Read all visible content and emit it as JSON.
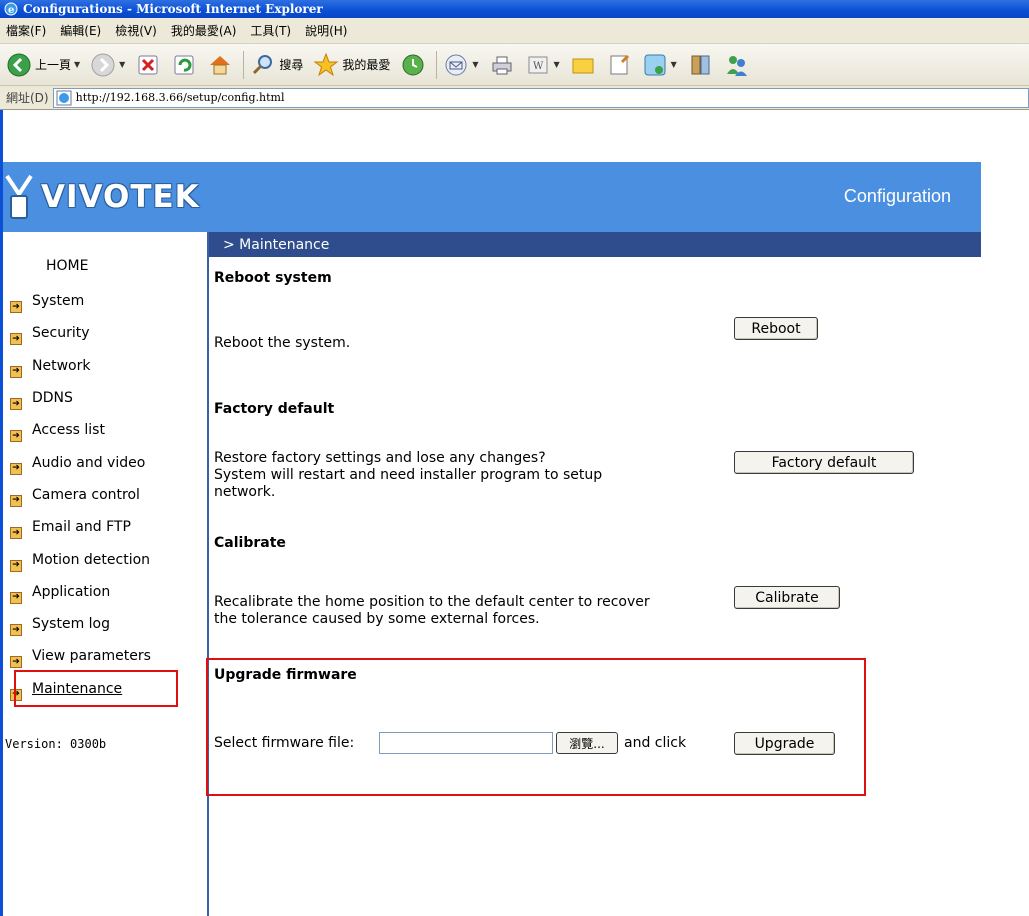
{
  "window": {
    "title": "Configurations - Microsoft Internet Explorer"
  },
  "menu": [
    "檔案(F)",
    "編輯(E)",
    "檢視(V)",
    "我的最愛(A)",
    "工具(T)",
    "說明(H)"
  ],
  "toolbar": {
    "back_label": "上一頁",
    "search_label": "搜尋",
    "favorites_label": "我的最愛"
  },
  "address": {
    "label": "網址(D)",
    "url": "http://192.168.3.66/setup/config.html"
  },
  "header": {
    "logo": "VIVOTEK",
    "title": "Configuration"
  },
  "section": {
    "breadcrumb": "> Maintenance"
  },
  "nav": {
    "home": "HOME",
    "items": [
      "System",
      "Security",
      "Network",
      "DDNS",
      "Access list",
      "Audio and video",
      "Camera control",
      "Email and FTP",
      "Motion detection",
      "Application",
      "System log",
      "View parameters",
      "Maintenance"
    ]
  },
  "version": "Version: 0300b",
  "reboot": {
    "title": "Reboot system",
    "text": "Reboot the system.",
    "button": "Reboot"
  },
  "factory": {
    "title": "Factory default",
    "line1": "Restore factory settings and lose any changes?",
    "line2": "System will restart and need installer program to setup",
    "line3": "network.",
    "button": "Factory default"
  },
  "calibrate": {
    "title": "Calibrate",
    "line1": "Recalibrate the home position to the default center to recover",
    "line2": "the tolerance caused by some external forces.",
    "button": "Calibrate"
  },
  "upgrade": {
    "title": "Upgrade firmware",
    "label": "Select firmware file:",
    "browse": "瀏覽...",
    "after": "and click",
    "button": "Upgrade"
  },
  "colors": {
    "header": "#4b8fe0",
    "section_bar": "#2f4d8c",
    "highlight": "#e01010"
  }
}
